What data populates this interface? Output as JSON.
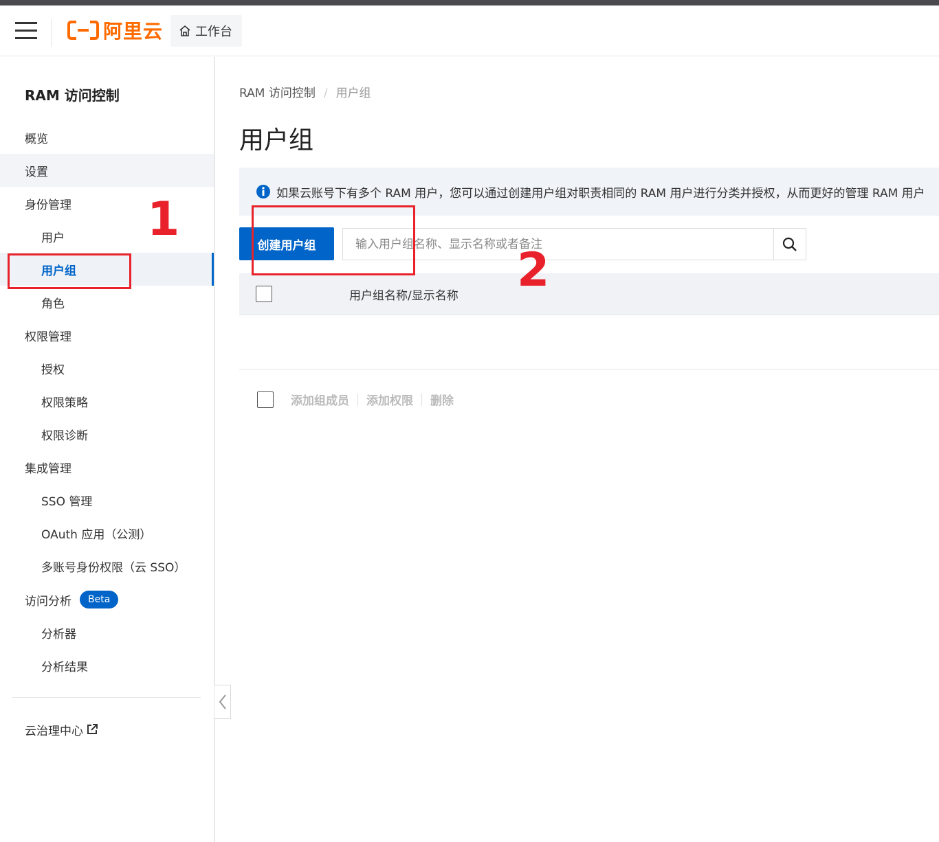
{
  "header": {
    "logo_text": "阿里云",
    "workbench_label": "工作台"
  },
  "sidebar": {
    "title": "RAM 访问控制",
    "items": [
      {
        "label": "概览"
      },
      {
        "label": "设置"
      },
      {
        "label": "身份管理"
      },
      {
        "label": "用户"
      },
      {
        "label": "用户组"
      },
      {
        "label": "角色"
      },
      {
        "label": "权限管理"
      },
      {
        "label": "授权"
      },
      {
        "label": "权限策略"
      },
      {
        "label": "权限诊断"
      },
      {
        "label": "集成管理"
      },
      {
        "label": "SSO 管理"
      },
      {
        "label": "OAuth 应用（公测）"
      },
      {
        "label": "多账号身份权限（云 SSO）"
      },
      {
        "label": "访问分析",
        "badge": "Beta"
      },
      {
        "label": "分析器"
      },
      {
        "label": "分析结果"
      },
      {
        "label": "云治理中心"
      }
    ]
  },
  "main": {
    "breadcrumb": [
      "RAM 访问控制",
      "用户组"
    ],
    "breadcrumb_sep": "/",
    "title": "用户组",
    "info_text": "如果云账号下有多个 RAM 用户，您可以通过创建用户组对职责相同的 RAM 用户进行分类并授权，从而更好的管理 RAM 用户",
    "create_button": "创建用户组",
    "search_placeholder": "输入用户组名称、显示名称或者备注",
    "table": {
      "columns": [
        "用户组名称/显示名称"
      ]
    },
    "bulk_actions": [
      "添加组成员",
      "添加权限",
      "删除"
    ]
  },
  "annotations": {
    "num1": "1",
    "num2": "2",
    "color": "#e8212b"
  },
  "colors": {
    "brand": "#ff6a00",
    "primary": "#0064c8"
  }
}
